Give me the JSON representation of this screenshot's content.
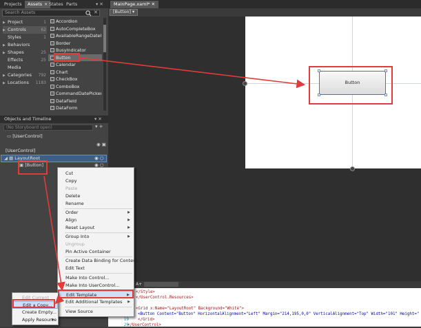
{
  "left_panel": {
    "tabs": [
      {
        "label": "Projects"
      },
      {
        "label": "Assets",
        "active": true
      },
      {
        "label": "States"
      },
      {
        "label": "Parts"
      }
    ],
    "window_controls": "▾ ✕",
    "search_placeholder": "Search Assets",
    "categories": [
      {
        "label": "Project",
        "count": "1"
      },
      {
        "label": "Controls",
        "count": "62"
      },
      {
        "label": "Styles",
        "count": "1"
      },
      {
        "label": "Behaviors",
        "count": ""
      },
      {
        "label": "Shapes",
        "count": "25"
      },
      {
        "label": "Effects",
        "count": "25"
      },
      {
        "label": "Media",
        "count": ""
      },
      {
        "label": "Categories",
        "count": "792"
      },
      {
        "label": "Locations",
        "count": "1183"
      }
    ],
    "controls": [
      "Accordion",
      "AutoCompleteBox",
      "AvailableRangeDatePi...",
      "Border",
      "BusyIndicator",
      "Button",
      "Calendar",
      "Chart",
      "CheckBox",
      "ComboBox",
      "CommandDatePicker",
      "DataField",
      "DataForm"
    ],
    "objects_header": "Objects and Timeline",
    "storyboard_placeholder": "(No Storyboard open)",
    "storyboard_controls": "▾ +",
    "tree": {
      "root_user_control": "[UserControl]",
      "user_control": "[UserControl]",
      "layout_root": "LayoutRoot",
      "button": "[Button]"
    }
  },
  "document": {
    "tab_label": "MainPage.xaml*",
    "tab_close": "✕",
    "breadcrumb": "[Button]",
    "button_content": "Button"
  },
  "context_menu": {
    "items": [
      {
        "label": "Cut"
      },
      {
        "label": "Copy"
      },
      {
        "label": "Paste",
        "disabled": true
      },
      {
        "label": "Delete"
      },
      {
        "label": "Rename"
      },
      {
        "label": "Order",
        "submenu": true
      },
      {
        "label": "Align",
        "submenu": true
      },
      {
        "label": "Reset Layout",
        "submenu": true
      },
      {
        "label": "Group Into",
        "submenu": true
      },
      {
        "label": "Ungroup",
        "disabled": true
      },
      {
        "label": "Pin Active Container"
      },
      {
        "label": "Create Data Binding for Content..."
      },
      {
        "label": "Edit Text"
      },
      {
        "label": "Make Into Control..."
      },
      {
        "label": "Make Into UserControl..."
      },
      {
        "label": "Edit Template",
        "submenu": true,
        "highlighted": true
      },
      {
        "label": "Edit Additional Templates",
        "submenu": true
      },
      {
        "label": "View Source"
      }
    ],
    "submenu_arrow": "▶",
    "template_submenu": [
      {
        "label": "Edit Current",
        "disabled": true
      },
      {
        "label": "Edit a Copy...",
        "highlighted": true
      },
      {
        "label": "Create Empty..."
      },
      {
        "label": "Apply Resource",
        "submenu": true
      }
    ]
  },
  "code": {
    "toolbar_label": "A+",
    "line_numbers": [
      "",
      "",
      "",
      "18",
      "19",
      "20"
    ],
    "lines": [
      "    </Style>",
      "</UserControl.Resources>",
      "<Grid x:Name=\"LayoutRoot\" Background=\"White\">",
      "    <Button Content=\"Button\" HorizontalAlignment=\"Left\" Margin=\"214,195,0,0\" VerticalAlignment=\"Top\" Width=\"101\" Height=\"",
      "</Grid>",
      "</UserControl>"
    ]
  },
  "colors": {
    "annotation_red": "#e13b3b",
    "panel_bg": "#434343",
    "selection_blue": "#3d5f86"
  }
}
